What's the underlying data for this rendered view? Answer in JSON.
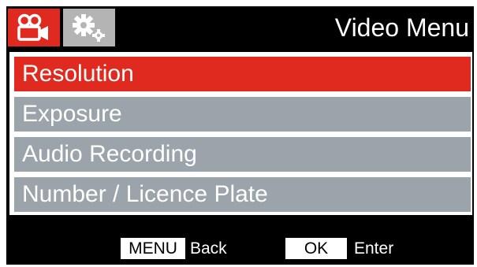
{
  "header": {
    "tabs": [
      {
        "icon": "video-camera-icon",
        "active": true,
        "color": "#e12a1f"
      },
      {
        "icon": "gears-icon",
        "active": false,
        "color": "#b4b4b4"
      }
    ],
    "title": "Video Menu"
  },
  "menu": {
    "items": [
      {
        "label": "Resolution",
        "selected": true
      },
      {
        "label": "Exposure",
        "selected": false
      },
      {
        "label": "Audio Recording",
        "selected": false
      },
      {
        "label": "Number / Licence Plate",
        "selected": false
      }
    ],
    "selected_color": "#e12a1f",
    "item_color": "#9ba4aa"
  },
  "footer": {
    "menu_key": "MENU",
    "menu_action": "Back",
    "ok_key": "OK",
    "ok_action": "Enter"
  }
}
